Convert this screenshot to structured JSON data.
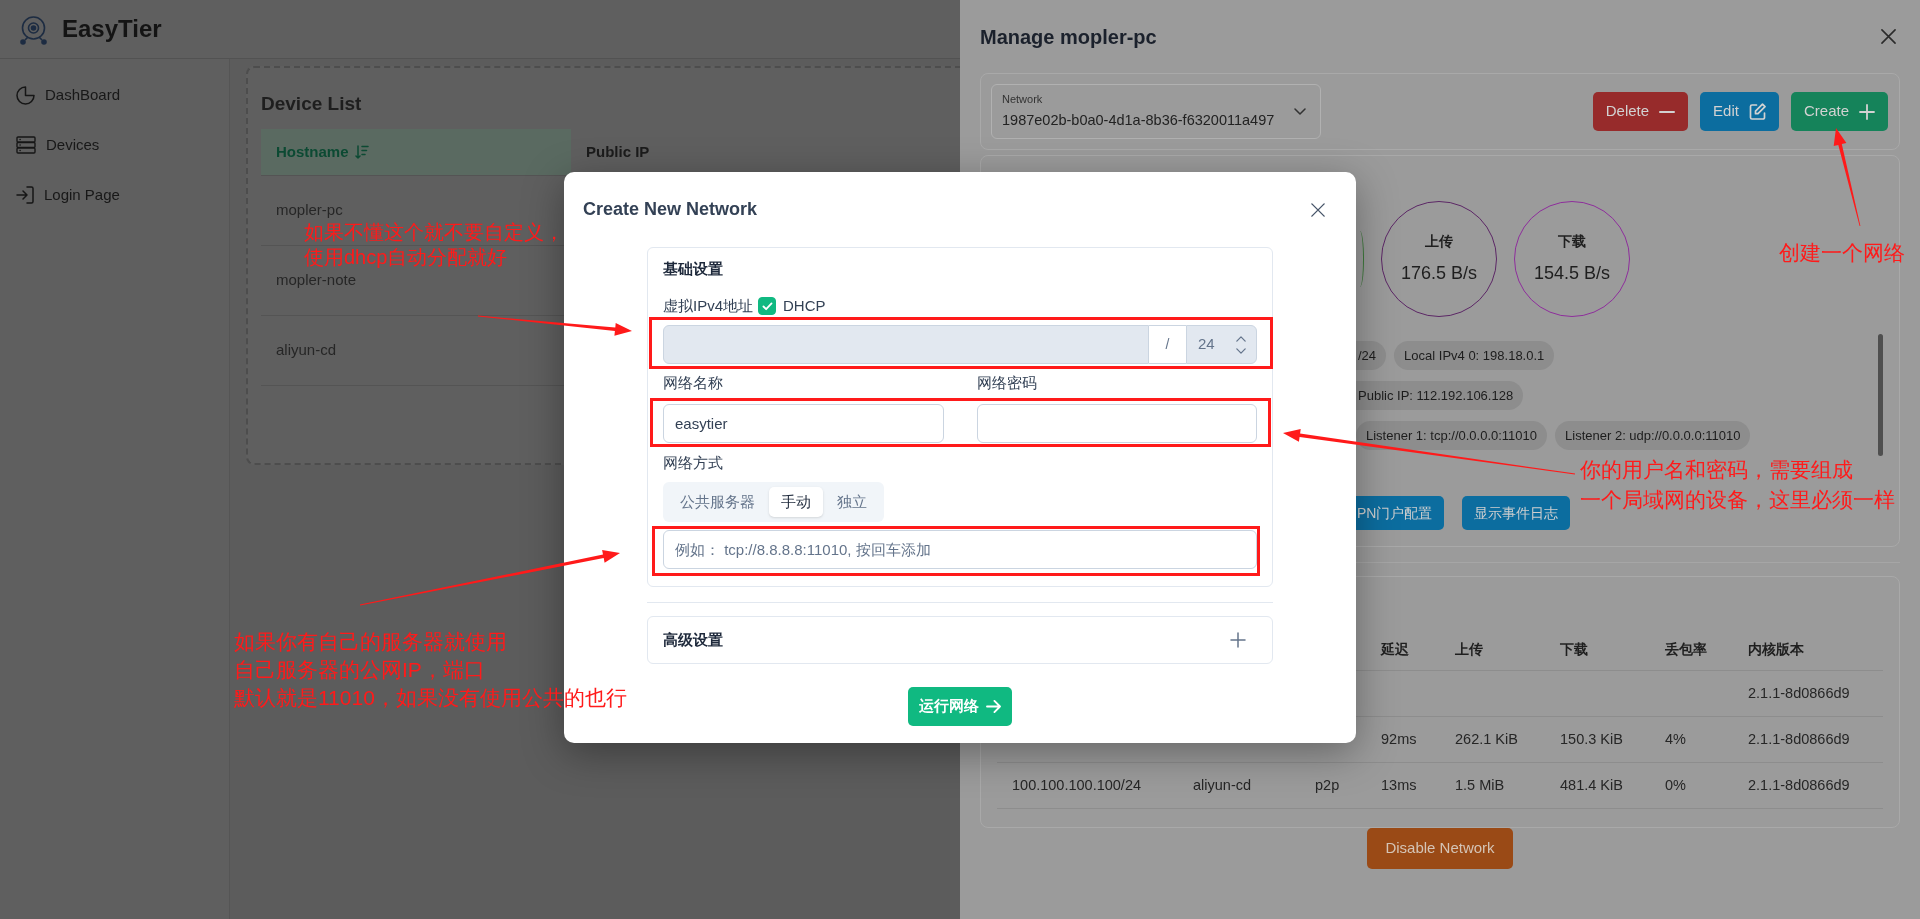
{
  "app": {
    "title": "EasyTier"
  },
  "sidebar": {
    "items": [
      {
        "label": "DashBoard",
        "kind": "chart"
      },
      {
        "label": "Devices",
        "kind": "server"
      },
      {
        "label": "Login Page",
        "kind": "login"
      }
    ]
  },
  "device_list": {
    "title": "Device List",
    "columns": [
      {
        "label": "Hostname",
        "sorted": true
      },
      {
        "label": "Public IP",
        "sorted": false
      }
    ],
    "rows": [
      "mopler-pc",
      "mopler-note",
      "aliyun-cd"
    ]
  },
  "drawer": {
    "title": "Manage mopler-pc",
    "network_select": {
      "label": "Network",
      "value": "1987e02b-b0a0-4d1a-8b36-f6320011a497"
    },
    "actions": [
      {
        "label": "Delete",
        "kind": "delete"
      },
      {
        "label": "Edit",
        "kind": "edit"
      },
      {
        "label": "Create",
        "kind": "create"
      }
    ],
    "stats": [
      {
        "kind": "edge",
        "color": "#3e7a3c"
      },
      {
        "kind": "ring",
        "label": "上传",
        "value": "176.5 B/s",
        "color": "#5c2766"
      },
      {
        "kind": "ring",
        "label": "下载",
        "value": "154.5 B/s",
        "color": "#8e2e9c"
      }
    ],
    "chip_rows": [
      [
        {
          "text": "/24",
          "kind": "cut"
        },
        {
          "text": "Local IPv4 0: 198.18.0.1",
          "kind": "whole"
        }
      ],
      [
        {
          "text": "Public IP: 112.192.106.128",
          "kind": "cut"
        }
      ],
      [
        {
          "text": "Listener 1: tcp://0.0.0.0:11010",
          "kind": "whole"
        },
        {
          "text": "Listener 2: udp://0.0.0.0:11010",
          "kind": "whole"
        }
      ]
    ],
    "buttons": [
      {
        "label": "PN门户配置",
        "kind": "cut"
      },
      {
        "label": "显示事件日志",
        "kind": "whole"
      }
    ],
    "peers_table": {
      "columns": [
        null,
        null,
        null,
        "延迟",
        "上传",
        "下载",
        "丢包率",
        "内核版本"
      ],
      "rows": [
        [
          null,
          null,
          null,
          null,
          null,
          null,
          null,
          "2.1.1-8d0866d9"
        ],
        [
          null,
          null,
          null,
          "92ms",
          "262.1 KiB",
          "150.3 KiB",
          "4%",
          "2.1.1-8d0866d9"
        ],
        [
          "100.100.100.100/24",
          "aliyun-cd",
          "p2p",
          "13ms",
          "1.5 MiB",
          "481.4 KiB",
          "0%",
          "2.1.1-8d0866d9"
        ]
      ]
    },
    "disable_button": "Disable Network"
  },
  "modal": {
    "title": "Create New Network",
    "basic": {
      "title": "基础设置",
      "ipv4_label": "虚拟IPv4地址",
      "dhcp": {
        "label": "DHCP",
        "checked": true
      },
      "separator": "/",
      "prefix": "24",
      "name_label": "网络名称",
      "name_value": "easytier",
      "secret_label": "网络密码",
      "mode_label": "网络方式",
      "modes": [
        {
          "label": "公共服务器",
          "selected": false
        },
        {
          "label": "手动",
          "selected": true
        },
        {
          "label": "独立",
          "selected": false
        }
      ],
      "peer_placeholder": "例如： tcp://8.8.8.8:11010, 按回车添加"
    },
    "advanced": {
      "title": "高级设置",
      "expanded": false
    },
    "submit": "运行网络"
  },
  "annotations": [
    {
      "lines": [
        "如果不懂这个就不要自定义，",
        "使用dhcp自动分配就好"
      ]
    },
    {
      "lines": [
        "创建一个网络"
      ]
    },
    {
      "lines": [
        "你的用户名和密码，需要组成",
        "一个局域网的设备，这里必须一样"
      ]
    },
    {
      "lines": [
        "如果你有自己的服务器就使用",
        "自己服务器的公网IP，端口",
        "默认就是11010，如果没有使用公共的也行"
      ]
    }
  ]
}
